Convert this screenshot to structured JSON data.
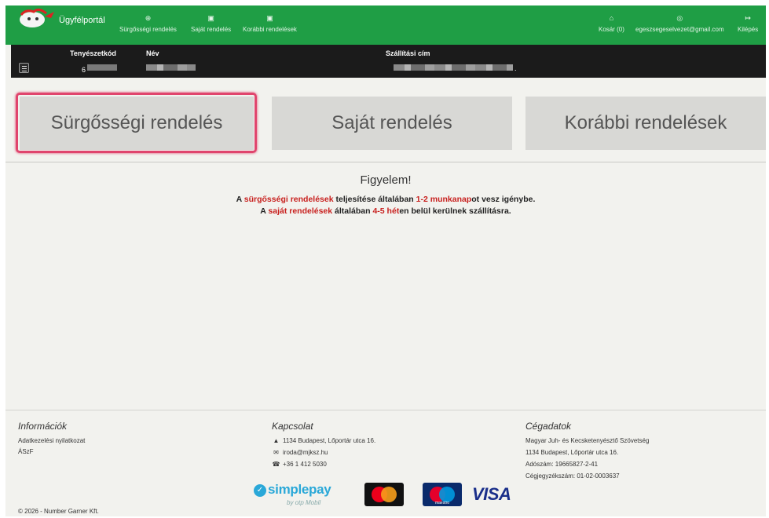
{
  "nav": {
    "brand": "Ügyfélportál",
    "items": [
      {
        "label": "Sürgősségi rendelés",
        "icon": "cart-icon"
      },
      {
        "label": "Saját rendelés",
        "icon": "document-icon"
      },
      {
        "label": "Korábbi rendelések",
        "icon": "document-icon"
      }
    ],
    "right": [
      {
        "label": "Kosár (0)",
        "icon": "basket-icon"
      },
      {
        "label": "egeszsegeselvezet@gmail.com",
        "icon": "user-icon"
      },
      {
        "label": "Kilépés",
        "icon": "logout-icon"
      }
    ],
    "color": "#1f9e45"
  },
  "infobar": {
    "col1_head": "Tenyészetkód",
    "col1_value": "6",
    "col2_head": "Név",
    "col3_head": "Szállítási cím",
    "col3_tail": "."
  },
  "buttons": {
    "urgent": "Sürgősségi rendelés",
    "own": "Saját rendelés",
    "previous": "Korábbi rendelések"
  },
  "notice": {
    "title": "Figyelem!",
    "l1_a": "A ",
    "l1_b": "sürgősségi rendelések",
    "l1_c": " teljesítése általában ",
    "l1_d": "1-2 munkanap",
    "l1_e": "ot vesz igénybe.",
    "l2_a": "A ",
    "l2_b": "saját rendelések",
    "l2_c": " általában ",
    "l2_d": "4-5 hét",
    "l2_e": "en belül kerülnek szállításra.",
    "accent": "#c8201e"
  },
  "footer": {
    "info_title": "Információk",
    "info_links": [
      "Adatkezelési nyilatkozat",
      "ÁSzF"
    ],
    "contact_title": "Kapcsolat",
    "address": "1134 Budapest, Lőportár utca 16.",
    "email": "iroda@mjksz.hu",
    "phone": "+36 1 412 5030",
    "company_title": "Cégadatok",
    "company_name": "Magyar Juh- és Kecsketenyésztő Szövetség",
    "company_address": "1134 Budapest, Lőportár utca 16.",
    "tax": "Adószám: 19665827-2-41",
    "registry": "Cégjegyzékszám: 01-02-0003637",
    "copyright": "© 2026 - Number Garner Kft."
  },
  "payment": {
    "simplepay": "simplepay",
    "simplepay_sub": "by otp Mobil",
    "maestro": "maestro",
    "visa": "VISA"
  }
}
